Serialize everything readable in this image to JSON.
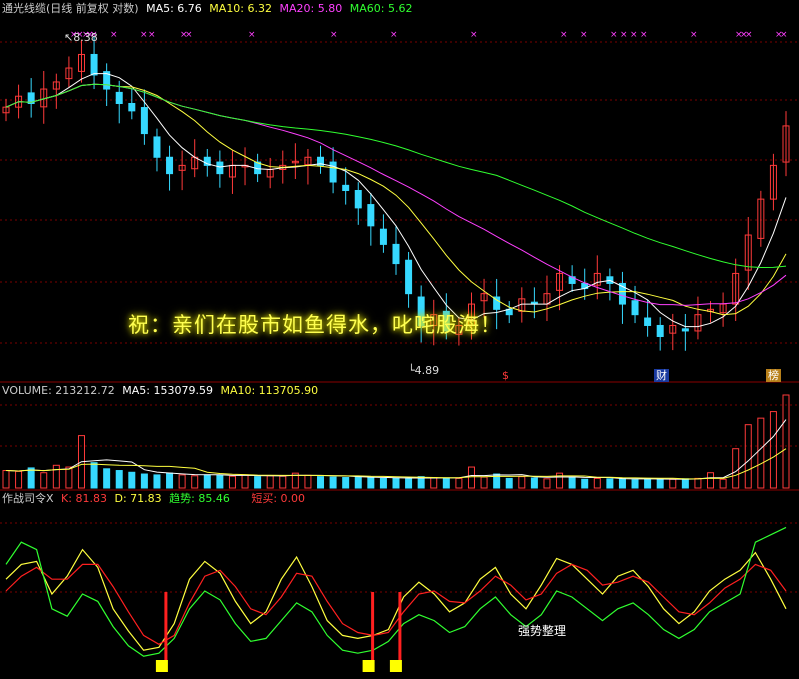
{
  "colors": {
    "up": "#ff3a3a",
    "down": "#36d9ff",
    "ma5": "#ffffff",
    "ma10": "#ffff40",
    "ma20": "#ff40ff",
    "ma60": "#30ff30",
    "k": "#ffff40",
    "d": "#ff2020",
    "trend": "#30ff30"
  },
  "price_header": {
    "title": "通光线缆(日线 前复权 对数)",
    "ma5_label": "MA5: 6.76",
    "ma10_label": "MA10: 6.32",
    "ma20_label": "MA20: 5.80",
    "ma60_label": "MA60: 5.62"
  },
  "price_annotations": {
    "high": "8.38",
    "low": "4.89",
    "tag_s": "$",
    "tag_cai": "财",
    "tag_bang": "榜"
  },
  "banner": "祝：亲们在股市如鱼得水，叱咤股海！",
  "volume_header": {
    "title": "VOLUME: 213212.72",
    "ma5_label": "MA5: 153079.59",
    "ma10_label": "MA10: 113705.90"
  },
  "indicator_header": {
    "title": "作战司令X",
    "k_label": "K: 81.83",
    "d_label": "D: 71.83",
    "trend_label": "趋势: 85.46",
    "short_buy_label": "短买: 0.00"
  },
  "indicator_annotation": "强势整理",
  "chart_data": [
    {
      "type": "candlestick",
      "title": "通光线缆(日线 前复权 对数)",
      "range": [
        4.89,
        8.38
      ],
      "marked_high": 8.38,
      "marked_low": 4.89,
      "indicators": {
        "MA5": 6.76,
        "MA10": 6.32,
        "MA20": 5.8,
        "MA60": 5.62
      },
      "close_trend": [
        7.55,
        7.7,
        7.6,
        7.8,
        7.9,
        8.1,
        8.3,
        8.0,
        7.8,
        7.6,
        7.5,
        7.2,
        6.9,
        6.7,
        6.8,
        6.9,
        6.8,
        6.7,
        6.8,
        6.8,
        6.7,
        6.75,
        6.8,
        6.85,
        6.9,
        6.8,
        6.6,
        6.5,
        6.3,
        6.1,
        5.9,
        5.7,
        5.4,
        5.1,
        5.2,
        5.05,
        5.1,
        5.3,
        5.4,
        5.25,
        5.2,
        5.35,
        5.3,
        5.4,
        5.6,
        5.5,
        5.45,
        5.6,
        5.5,
        5.3,
        5.2,
        5.1,
        5.0,
        5.1,
        5.05,
        5.2,
        5.25,
        5.3,
        5.6,
        6.0,
        6.4,
        6.8,
        7.3
      ]
    },
    {
      "type": "bar",
      "title": "VOLUME: 213212.72",
      "indicators": {
        "MA5": 153079.59,
        "MA10": 113705.9
      },
      "values": [
        40,
        38,
        46,
        35,
        52,
        48,
        120,
        58,
        44,
        40,
        36,
        32,
        30,
        34,
        30,
        28,
        30,
        29,
        27,
        30,
        26,
        28,
        27,
        34,
        29,
        26,
        25,
        24,
        27,
        23,
        22,
        22,
        21,
        26,
        24,
        23,
        22,
        48,
        25,
        32,
        22,
        26,
        23,
        21,
        34,
        23,
        20,
        22,
        21,
        22,
        19,
        21,
        20,
        20,
        21,
        22,
        35,
        20,
        90,
        145,
        160,
        175,
        213
      ]
    },
    {
      "type": "line",
      "title": "作战司令X",
      "indicators": {
        "K": 81.83,
        "D": 71.83,
        "趋势": 85.46,
        "短买": 0.0
      },
      "series": [
        {
          "name": "K",
          "values": [
            60,
            70,
            72,
            50,
            62,
            80,
            68,
            40,
            25,
            12,
            14,
            30,
            60,
            72,
            64,
            45,
            30,
            38,
            60,
            75,
            55,
            32,
            22,
            20,
            22,
            26,
            48,
            58,
            50,
            38,
            44,
            60,
            68,
            50,
            40,
            56,
            74,
            70,
            60,
            50,
            62,
            66,
            55,
            40,
            30,
            38,
            52,
            60,
            66,
            78,
            60,
            40
          ]
        },
        {
          "name": "D",
          "values": [
            52,
            62,
            68,
            60,
            60,
            70,
            70,
            55,
            38,
            22,
            16,
            22,
            44,
            62,
            66,
            55,
            40,
            36,
            48,
            64,
            62,
            45,
            30,
            24,
            22,
            24,
            38,
            50,
            52,
            45,
            44,
            52,
            62,
            56,
            46,
            50,
            64,
            70,
            66,
            56,
            58,
            62,
            58,
            48,
            38,
            36,
            44,
            54,
            60,
            70,
            66,
            52
          ]
        },
        {
          "name": "趋势",
          "values": [
            70,
            85,
            80,
            40,
            35,
            50,
            45,
            28,
            15,
            8,
            10,
            20,
            40,
            52,
            46,
            30,
            18,
            20,
            32,
            44,
            38,
            22,
            12,
            10,
            12,
            18,
            30,
            36,
            32,
            24,
            28,
            40,
            48,
            36,
            28,
            36,
            52,
            48,
            40,
            32,
            40,
            44,
            36,
            26,
            20,
            26,
            38,
            44,
            50,
            85,
            90,
            95
          ]
        }
      ],
      "short_buy_marks": [
        0.205,
        0.47,
        0.505
      ]
    }
  ]
}
